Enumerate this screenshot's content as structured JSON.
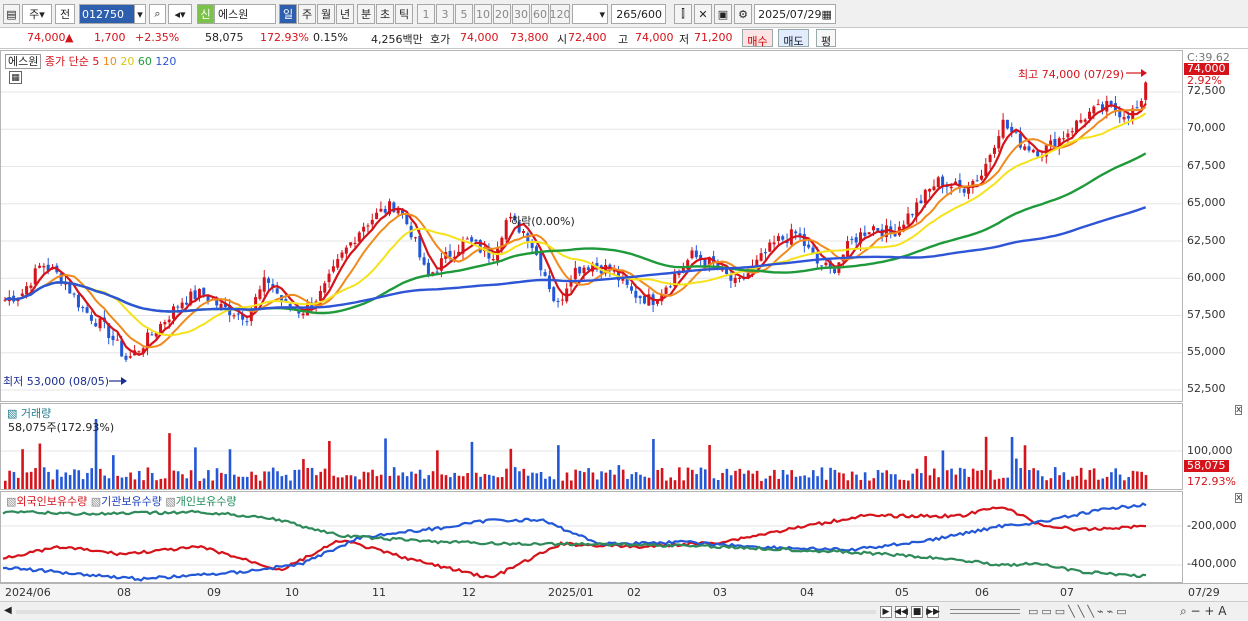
{
  "toolbar": {
    "period": "주",
    "mode": "전",
    "code": "012750",
    "name": "에스원",
    "badge": "신",
    "intervals": [
      "일",
      "주",
      "월",
      "년",
      "분",
      "초",
      "틱"
    ],
    "nums": [
      "1",
      "3",
      "5",
      "10",
      "20",
      "30",
      "60",
      "120"
    ],
    "count": "265",
    "max": "/600",
    "date": "2025/07/29"
  },
  "info": {
    "price": "74,000",
    "arrow": "▲",
    "change": "1,700",
    "rate": "+2.35%",
    "volume": "58,075",
    "volrate": "172.93%",
    "turnover": "0.15%",
    "amount": "4,256백만",
    "hoga_label": "호가",
    "ask": "74,000",
    "bid": "73,800",
    "open_label": "시",
    "open": "72,400",
    "high_label": "고",
    "high": "74,000",
    "low_label": "저",
    "low": "71,200",
    "buy": "매수",
    "sell": "매도",
    "flat": "평"
  },
  "legend": {
    "name": "에스원",
    "ma_label": "종가 단순",
    "ma": [
      "5",
      "10",
      "20",
      "60",
      "120"
    ]
  },
  "annot": {
    "high": "최고 74,000 (07/29)",
    "low": "최저 53,000 (08/05)",
    "drop": "하락(0.00%)"
  },
  "price_axis": {
    "top": "C:39.62",
    "labels": [
      "72,500",
      "70,000",
      "67,500",
      "65,000",
      "62,500",
      "60,000",
      "57,500",
      "55,000",
      "52,500"
    ],
    "cur": "74,000",
    "pct": "2.92%"
  },
  "volume": {
    "title": "거래량",
    "value": "58,075주(172.93%)",
    "axis": "100,000",
    "cur": "58,075",
    "pct": "172.93%"
  },
  "holders": {
    "foreign": "외국인보유수량",
    "inst": "기관보유수량",
    "indiv": "개인보유수량",
    "axis": [
      "-200,000",
      "-400,000"
    ]
  },
  "xaxis": {
    "labels": [
      "2024/06",
      "08",
      "09",
      "10",
      "11",
      "12",
      "2025/01",
      "02",
      "03",
      "04",
      "05",
      "06",
      "07"
    ],
    "end": "07/29"
  },
  "colors": {
    "up": "#d4131b",
    "down": "#2257d6",
    "ma5": "#d4131b",
    "ma10": "#f08a1c",
    "ma20": "#f5e21a",
    "ma60": "#1f9a3a",
    "ma120": "#2e55d6"
  },
  "chart_data": {
    "type": "line",
    "x_range": [
      "2024/06",
      "2025/07/29"
    ],
    "y_range": [
      52500,
      74000
    ],
    "high": 74000,
    "low": 53000,
    "last": 74000,
    "series": [
      {
        "name": "5",
        "role": "moving average"
      },
      {
        "name": "10",
        "role": "moving average"
      },
      {
        "name": "20",
        "role": "moving average"
      },
      {
        "name": "60",
        "role": "moving average"
      },
      {
        "name": "120",
        "role": "moving average"
      }
    ]
  }
}
